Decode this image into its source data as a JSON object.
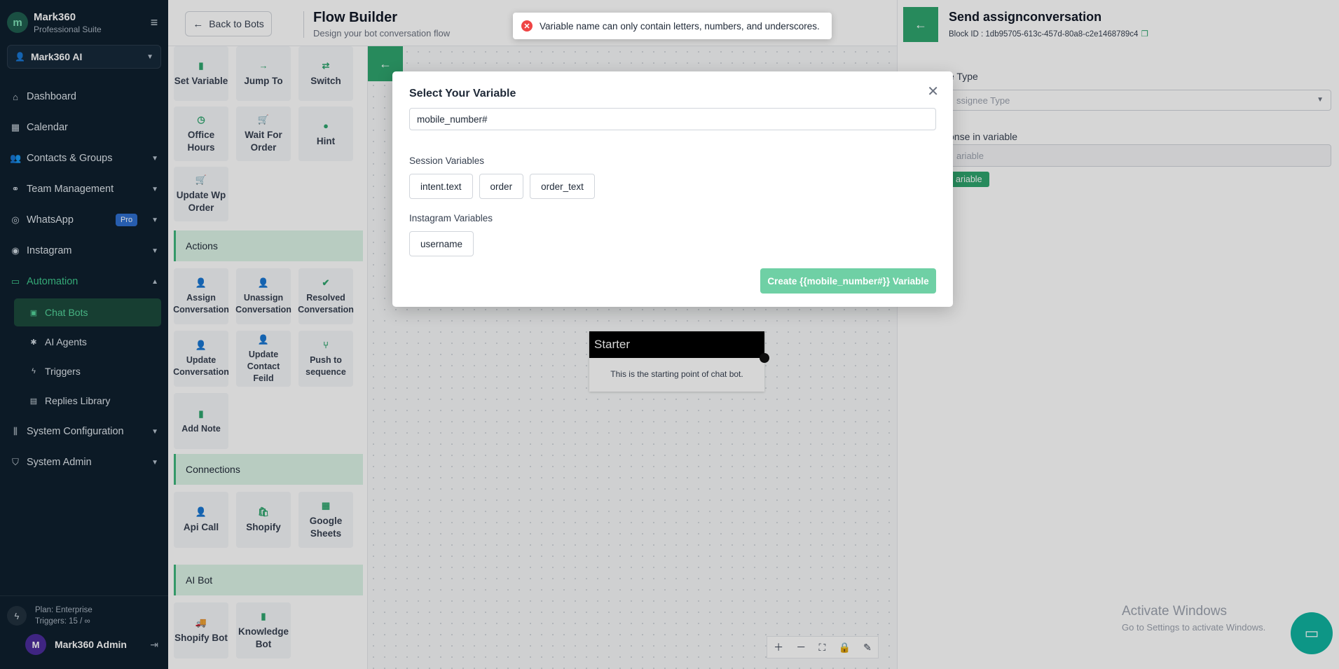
{
  "sidebar": {
    "brand_name": "Mark360",
    "brand_sub": "Professional Suite",
    "workspace": "Mark360 AI",
    "nav": [
      {
        "label": "Dashboard",
        "icon": "home-icon"
      },
      {
        "label": "Calendar",
        "icon": "calendar-icon"
      },
      {
        "label": "Contacts & Groups",
        "icon": "users-icon"
      },
      {
        "label": "Team Management",
        "icon": "team-icon"
      },
      {
        "label": "WhatsApp",
        "icon": "whatsapp-icon",
        "badge": "Pro"
      },
      {
        "label": "Instagram",
        "icon": "instagram-icon"
      },
      {
        "label": "Automation",
        "icon": "monitor-icon"
      },
      {
        "label": "System Configuration",
        "icon": "sliders-icon"
      },
      {
        "label": "System Admin",
        "icon": "shield-icon"
      }
    ],
    "automation_sub": [
      {
        "label": "Chat Bots",
        "icon": "bot-icon"
      },
      {
        "label": "AI Agents",
        "icon": "sparkle-icon"
      },
      {
        "label": "Triggers",
        "icon": "bolt-icon"
      },
      {
        "label": "Replies Library",
        "icon": "chat-icon"
      }
    ],
    "plan": "Plan: Enterprise",
    "triggers": "Triggers: 15 / ∞",
    "avatar_initial": "M",
    "user_name": "Mark360 Admin"
  },
  "header": {
    "back_label": "Back to Bots",
    "title": "Flow Builder",
    "subtitle": "Design your bot conversation flow"
  },
  "palette": {
    "flow_tiles": [
      "Set Variable",
      "Jump To",
      "Switch",
      "Office Hours",
      "Wait For Order",
      "Hint",
      "Update Wp Order"
    ],
    "actions_label": "Actions",
    "action_tiles": [
      "Assign Conversation",
      "Unassign Conversation",
      "Resolved Conversation",
      "Update Conversation",
      "Update Contact Feild",
      "Push to sequence",
      "Add Note"
    ],
    "connections_label": "Connections",
    "connection_tiles": [
      "Api Call",
      "Shopify",
      "Google Sheets"
    ],
    "ai_label": "AI Bot",
    "ai_tiles": [
      "Shopify Bot",
      "Knowledge Bot"
    ]
  },
  "canvas": {
    "starter_title": "Starter",
    "starter_body": "This is the starting point of chat bot."
  },
  "right_panel": {
    "title": "Send assignconversation",
    "block_id": "Block ID :  1db95705-613c-457d-80a8-c2e1468789c4",
    "assignee_label": "e Type",
    "assignee_placeholder": "ssignee Type",
    "response_label": "onse in variable",
    "response_placeholder": "ariable",
    "chip_label": "ariable",
    "watermark": "Activate Windows",
    "watermark_sub": "Go to Settings to activate Windows."
  },
  "modal": {
    "title": "Select Your Variable",
    "input_value": "mobile_number#",
    "session_label": "Session Variables",
    "session_vars": [
      "intent.text",
      "order",
      "order_text"
    ],
    "instagram_label": "Instagram Variables",
    "instagram_vars": [
      "username"
    ],
    "create_label": "Create {{mobile_number#}} Variable"
  },
  "toast": {
    "message": "Variable name can only contain letters, numbers, and underscores."
  },
  "colors": {
    "accent": "#2fa56e",
    "sidebar_bg": "#0f1f2e",
    "error": "#ef4444"
  }
}
